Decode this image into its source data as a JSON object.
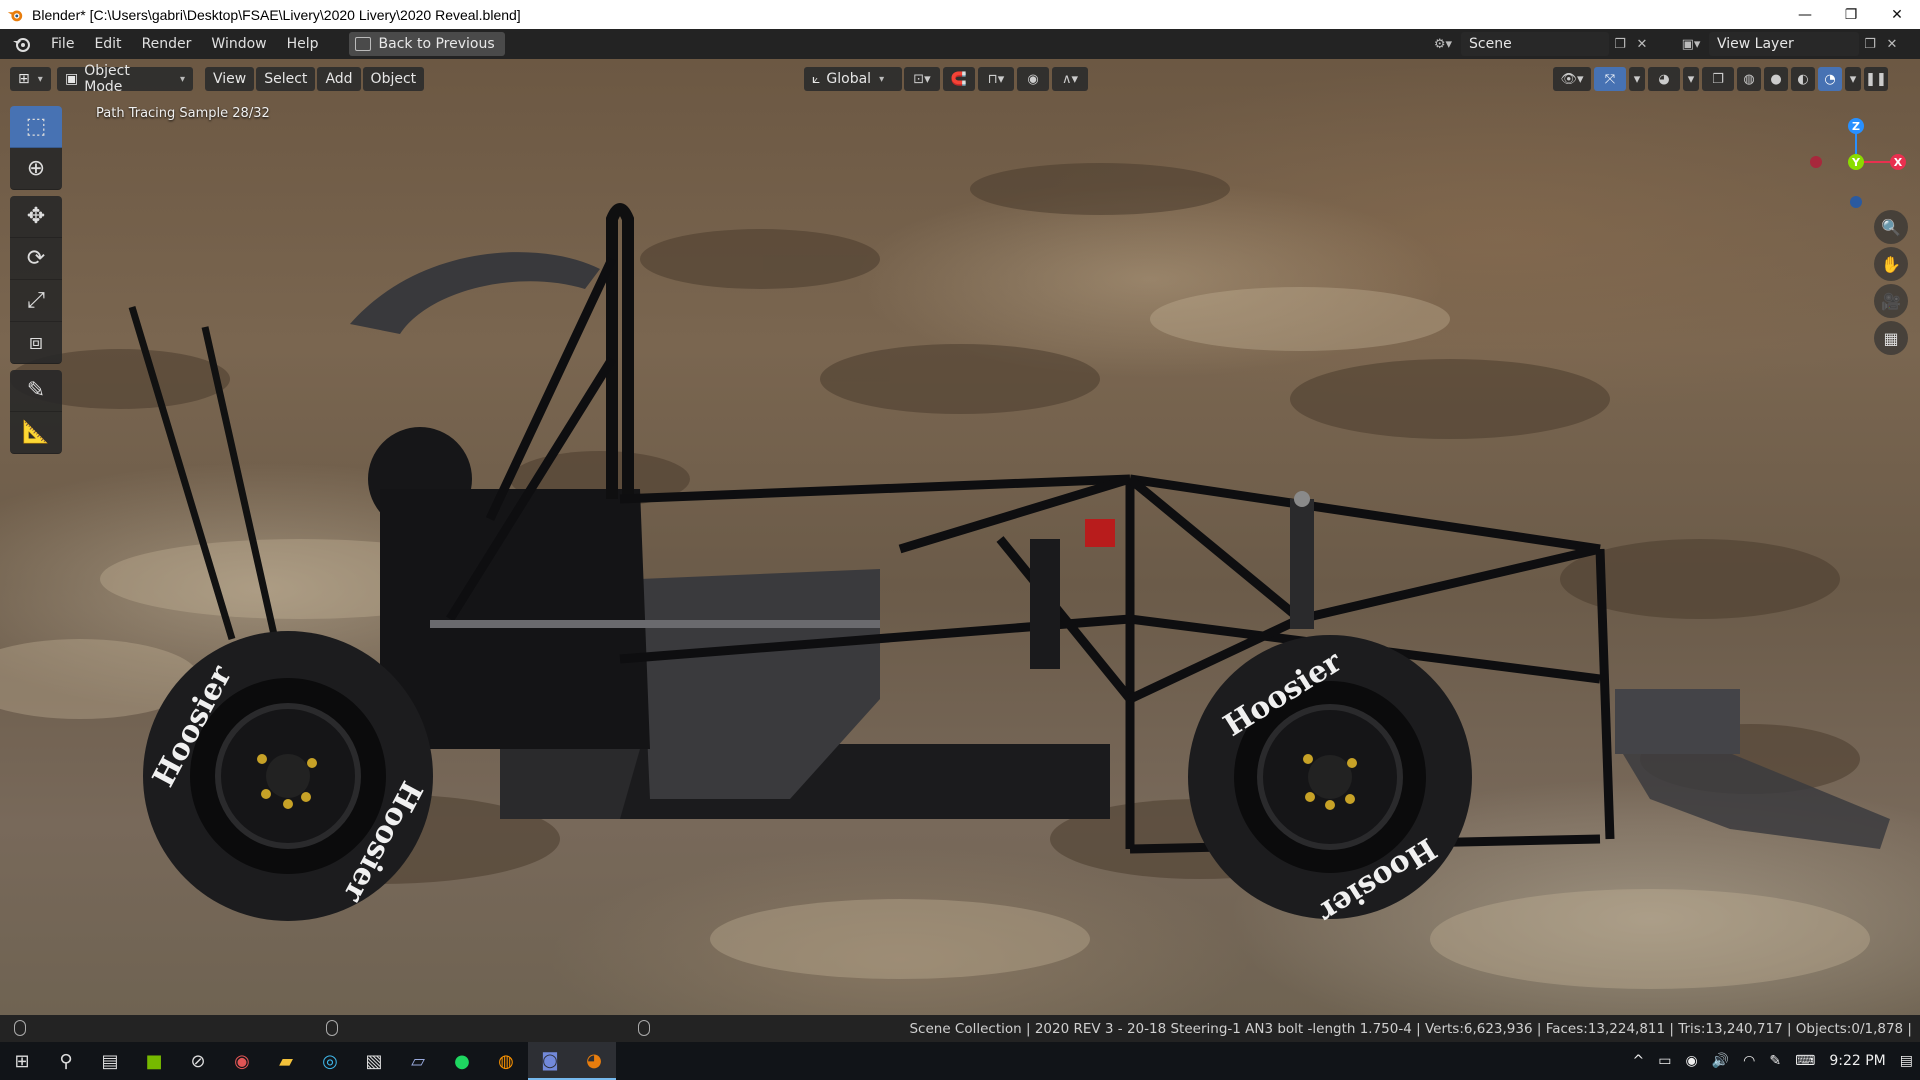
{
  "window": {
    "title": "Blender* [C:\\Users\\gabri\\Desktop\\FSAE\\Livery\\2020 Livery\\2020 Reveal.blend]",
    "controls": [
      "—",
      "❐",
      "✕"
    ]
  },
  "menubar": {
    "items": [
      "File",
      "Edit",
      "Render",
      "Window",
      "Help"
    ],
    "back_label": "Back to Previous",
    "scene": "Scene",
    "view_layer": "View Layer"
  },
  "viewport": {
    "mode": "Object Mode",
    "menus": [
      "View",
      "Select",
      "Add",
      "Object"
    ],
    "orientation": "Global",
    "overlay_text": "Path Tracing Sample 28/32",
    "gizmo": {
      "z": "Z",
      "y": "Y",
      "x": "X"
    },
    "tire_text": "Hoosier"
  },
  "tools": [
    "select-box-icon",
    "cursor-icon",
    "move-icon",
    "rotate-icon",
    "scale-icon",
    "transform-icon",
    "annotate-icon",
    "measure-icon"
  ],
  "statusbar": {
    "text": "Scene Collection | 2020 REV 3 - 20-18 Steering-1 AN3 bolt -length 1.750-4 | Verts:6,623,936 | Faces:13,224,811 | Tris:13,240,717 | Objects:0/1,878 |"
  },
  "taskbar": {
    "apps": [
      "start-icon",
      "search-icon",
      "task-view-icon",
      "nvidia-icon",
      "app-icon",
      "app2-icon",
      "file-explorer-icon",
      "edge-icon",
      "photos-icon",
      "notepad-icon",
      "spotify-icon",
      "firefox-icon",
      "discord-icon",
      "blender-icon"
    ],
    "time": "9:22 PM"
  },
  "colors": {
    "accent": "#4772b3",
    "axis_x": "#e8304f",
    "axis_y": "#8bdc00",
    "axis_z": "#2890ff"
  }
}
